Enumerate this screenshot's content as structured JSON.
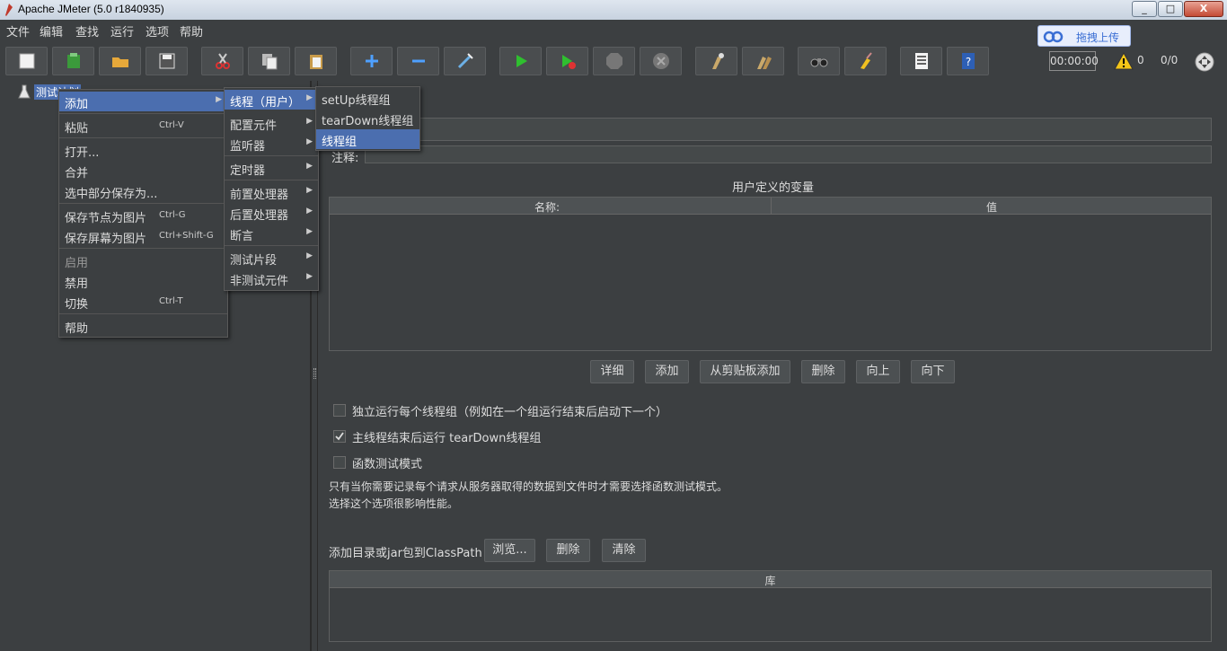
{
  "window": {
    "title": "Apache JMeter (5.0 r1840935)",
    "minimize": "_",
    "maximize": "□",
    "close": "X"
  },
  "menubar": [
    "文件",
    "编辑",
    "查找",
    "运行",
    "选项",
    "帮助"
  ],
  "toolbar": {
    "buttons": [
      "new-icon",
      "templates-icon",
      "open-icon",
      "save-icon",
      "cut-icon",
      "copy-icon",
      "paste-icon",
      "expand-icon",
      "collapse-icon",
      "toggle-icon",
      "start-icon",
      "start-no-pauses-icon",
      "stop-icon",
      "shutdown-icon",
      "clear-icon",
      "clear-all-icon",
      "search-icon",
      "reset-search-icon",
      "function-helper-icon",
      "help-icon"
    ],
    "timer": "00:00:00",
    "warning_count": "0",
    "threads": "0/0"
  },
  "baidu_widget": {
    "label": "拖拽上传"
  },
  "tree": {
    "root_label": "测试计划"
  },
  "test_plan": {
    "comment_label": "注释:",
    "user_vars_title": "用户定义的变量",
    "table_headers": [
      "名称:",
      "值"
    ],
    "buttons": [
      "详细",
      "添加",
      "从剪贴板添加",
      "删除",
      "向上",
      "向下"
    ],
    "checkboxes": [
      {
        "label": "独立运行每个线程组（例如在一个组运行结束后启动下一个）",
        "checked": false
      },
      {
        "label": "主线程结束后运行 tearDown线程组",
        "checked": true
      },
      {
        "label": "函数测试模式",
        "checked": false
      }
    ],
    "note_line1": "只有当你需要记录每个请求从服务器取得的数据到文件时才需要选择函数测试模式。",
    "note_line2": "选择这个选项很影响性能。",
    "classpath_label": "添加目录或jar包到ClassPath",
    "classpath_buttons": [
      "浏览...",
      "删除",
      "清除"
    ],
    "lib_header": "库"
  },
  "context_menu": {
    "items": [
      {
        "label": "添加",
        "submenu": true
      },
      {
        "label": "粘贴",
        "shortcut": "Ctrl-V"
      },
      {
        "label": "打开..."
      },
      {
        "label": "合并"
      },
      {
        "label": "选中部分保存为..."
      },
      {
        "label": "保存节点为图片",
        "shortcut": "Ctrl-G"
      },
      {
        "label": "保存屏幕为图片",
        "shortcut": "Ctrl+Shift-G"
      },
      {
        "label": "启用",
        "disabled": true
      },
      {
        "label": "禁用"
      },
      {
        "label": "切换",
        "shortcut": "Ctrl-T"
      },
      {
        "label": "帮助"
      }
    ]
  },
  "add_submenu": {
    "items": [
      "线程（用户）",
      "配置元件",
      "监听器",
      "定时器",
      "前置处理器",
      "后置处理器",
      "断言",
      "测试片段",
      "非测试元件"
    ]
  },
  "threads_submenu": {
    "items": [
      "setUp线程组",
      "tearDown线程组",
      "线程组"
    ]
  }
}
